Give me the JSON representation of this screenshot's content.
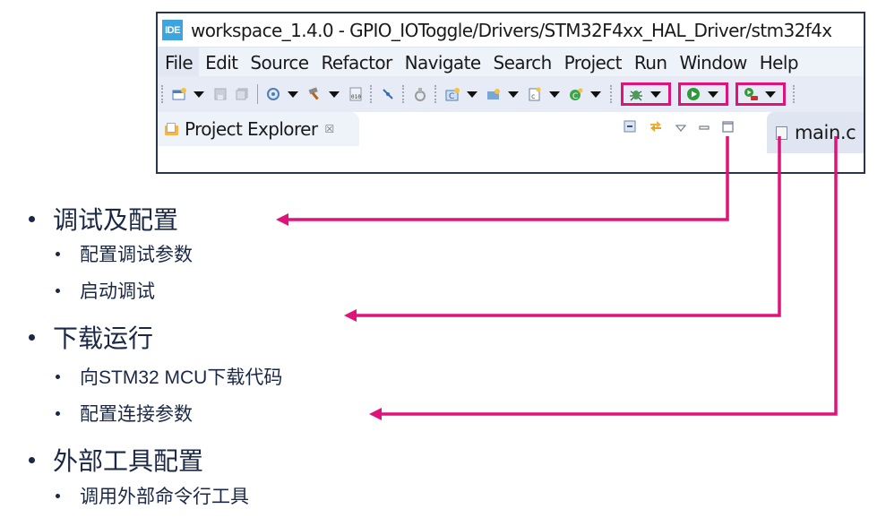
{
  "ide": {
    "logo_text": "IDE",
    "window_title": "workspace_1.4.0 - GPIO_IOToggle/Drivers/STM32F4xx_HAL_Driver/stm32f4x",
    "menu": [
      "File",
      "Edit",
      "Source",
      "Refactor",
      "Navigate",
      "Search",
      "Project",
      "Run",
      "Window",
      "Help"
    ],
    "toolbar_icons": [
      "new-icon",
      "save-icon",
      "save-all-icon",
      "build-settings-icon",
      "build-icon",
      "binary-file-icon",
      "link-icon",
      "target-icon",
      "new-c-project-icon",
      "new-folder-icon",
      "new-c-file-icon",
      "new-class-icon",
      "debug-icon",
      "run-icon",
      "external-tools-icon"
    ],
    "project_explorer": {
      "label": "Project Explorer",
      "close_glyph": "☒"
    },
    "editor_tab": {
      "label": "main.c"
    },
    "highlight_color": "#e0137a"
  },
  "bullets": [
    {
      "label": "调试及配置",
      "points_to": "debug-icon",
      "children": [
        "配置调试参数",
        "启动调试"
      ]
    },
    {
      "label": "下载运行",
      "points_to": "run-icon",
      "children": [
        "向STM32 MCU下载代码",
        "配置连接参数"
      ]
    },
    {
      "label": "外部工具配置",
      "points_to": "external-tools-icon",
      "children": [
        "调用外部命令行工具"
      ]
    }
  ]
}
